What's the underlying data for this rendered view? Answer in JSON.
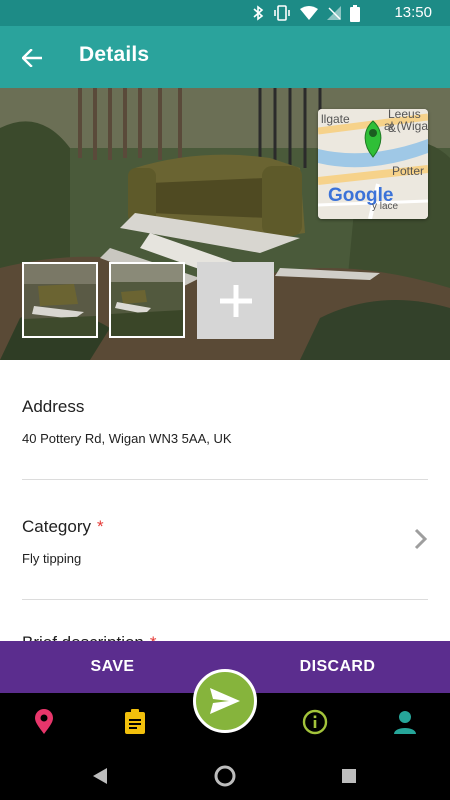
{
  "status_bar": {
    "time": "13:50",
    "icons": [
      "bluetooth-icon",
      "vibrate-icon",
      "wifi-icon",
      "no-signal-icon",
      "battery-icon"
    ]
  },
  "app_bar": {
    "title": "Details"
  },
  "map_preview": {
    "labels": [
      "llgate",
      "Leeus &",
      "al (Wiga",
      "Potter",
      "Google",
      "y lace"
    ]
  },
  "form": {
    "address_label": "Address",
    "address_value": "40 Pottery Rd, Wigan WN3 5AA, UK",
    "category_label": "Category",
    "category_required": "*",
    "category_value": "Fly tipping",
    "description_label": "Brief description",
    "description_required": "*"
  },
  "actions": {
    "save": "SAVE",
    "discard": "DISCARD"
  },
  "bottom_nav": {
    "items": [
      "map-pin-icon",
      "clipboard-icon",
      "send-icon",
      "info-icon",
      "account-icon"
    ],
    "colors": {
      "pin": "#e8366b",
      "clipboard": "#f2c00c",
      "fab": "#86b43c",
      "info": "#a3c33b",
      "account": "#26a69a"
    }
  },
  "theme": {
    "status_bar": "#1d8b86",
    "app_bar": "#2aa39c",
    "action_bar": "#5b2d8e"
  }
}
